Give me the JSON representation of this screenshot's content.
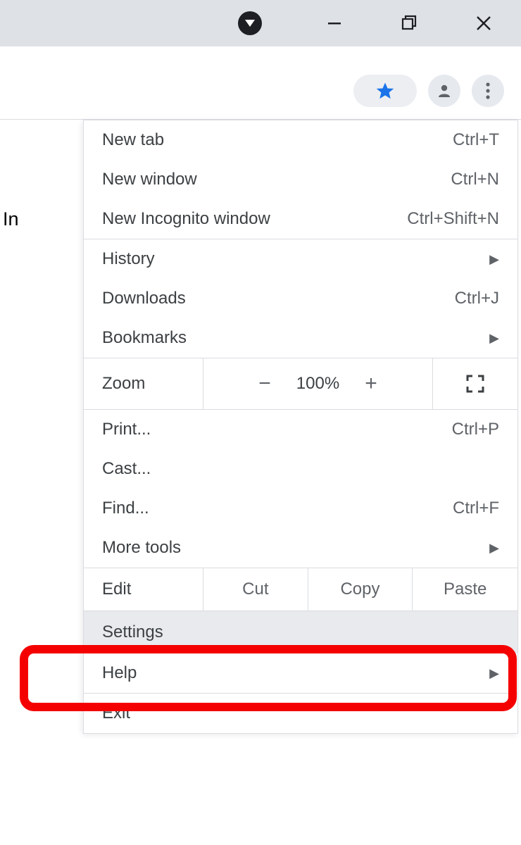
{
  "titlebar": {
    "dropdown_icon": "dropdown-triangle",
    "minimize_icon": "minimize",
    "maximize_icon": "maximize",
    "close_icon": "close"
  },
  "toolbar": {
    "bookmark_icon": "star",
    "profile_icon": "person",
    "menu_icon": "kebab"
  },
  "page_partial_text": "In",
  "menu": {
    "items": [
      {
        "label": "New tab",
        "shortcut": "Ctrl+T"
      },
      {
        "label": "New window",
        "shortcut": "Ctrl+N"
      },
      {
        "label": "New Incognito window",
        "shortcut": "Ctrl+Shift+N"
      }
    ],
    "history": {
      "label": "History"
    },
    "downloads": {
      "label": "Downloads",
      "shortcut": "Ctrl+J"
    },
    "bookmarks": {
      "label": "Bookmarks"
    },
    "zoom": {
      "label": "Zoom",
      "minus": "−",
      "level": "100%",
      "plus": "+",
      "fullscreen_icon": "fullscreen"
    },
    "print": {
      "label": "Print...",
      "shortcut": "Ctrl+P"
    },
    "cast": {
      "label": "Cast..."
    },
    "find": {
      "label": "Find...",
      "shortcut": "Ctrl+F"
    },
    "moretools": {
      "label": "More tools"
    },
    "edit": {
      "label": "Edit",
      "cut": "Cut",
      "copy": "Copy",
      "paste": "Paste"
    },
    "settings": {
      "label": "Settings"
    },
    "help": {
      "label": "Help"
    },
    "exit": {
      "label": "Exit"
    }
  },
  "colors": {
    "highlight": "#f40000",
    "titlebar_bg": "#dee1e6",
    "star": "#1a73e8"
  }
}
